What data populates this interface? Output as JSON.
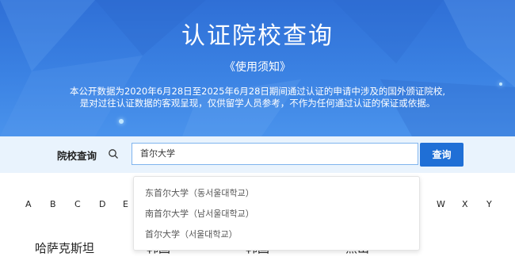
{
  "header": {
    "title": "认证院校查询",
    "subtitle": "《使用须知》",
    "notice_line1": "本公开数据为2020年6月28日至2025年6月28日期间通过认证的申请中涉及的国外颁证院校,",
    "notice_line2": "是对过往认证数据的客观呈现，仅供留学人员参考，不作为任何通过认证的保证或依据。"
  },
  "search": {
    "label": "院校查询",
    "value": "首尔大学",
    "button_label": "查询",
    "suggestions": [
      "东首尔大学（동서울대학교）",
      "南首尔大学（남서울대학교）",
      "首尔大学（서울대학교）"
    ]
  },
  "letters": [
    "A",
    "B",
    "C",
    "D",
    "E",
    "W",
    "X",
    "Y"
  ],
  "countries": [
    "哈萨克斯坦",
    "韩国",
    "韩国",
    "黑山"
  ],
  "colors": {
    "banner": "#3b82e3",
    "button": "#1f6fd6",
    "search_bg": "#e9f3fd"
  }
}
